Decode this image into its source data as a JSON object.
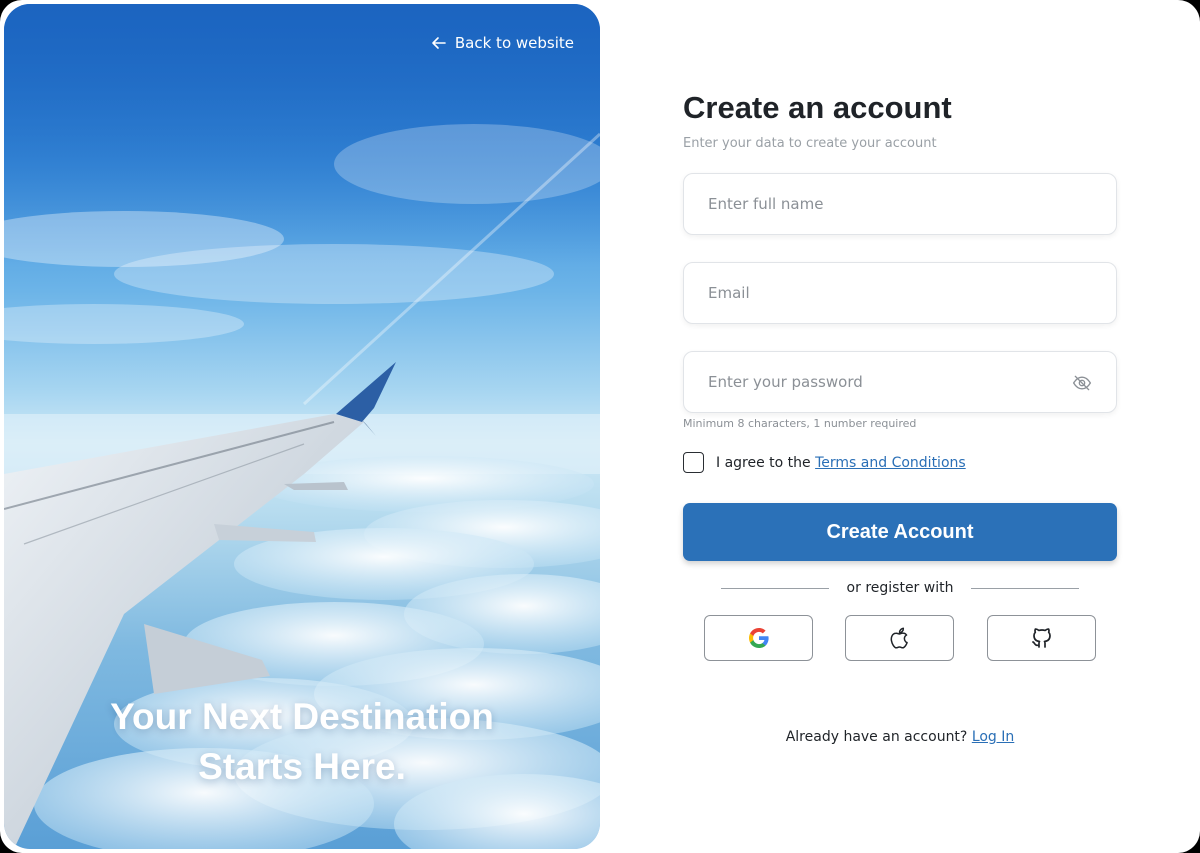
{
  "hero": {
    "back_link": "Back to website",
    "tagline_line1": "Your Next Destination",
    "tagline_line2": "Starts Here."
  },
  "form": {
    "title": "Create an account",
    "subtitle": "Enter your data to create your account",
    "full_name_placeholder": "Enter full name",
    "email_placeholder": "Email",
    "password_placeholder": "Enter your password",
    "password_hint": "Minimum 8 characters, 1 number required",
    "agree_prefix": "I agree to the ",
    "terms_link": "Terms and Conditions",
    "submit_label": "Create Account",
    "divider_text": "or register with",
    "login_prompt": "Already have an account? ",
    "login_link": "Log In"
  },
  "social": [
    {
      "name": "google-icon"
    },
    {
      "name": "apple-icon"
    },
    {
      "name": "github-icon"
    }
  ],
  "colors": {
    "primary": "#2b71b8",
    "link": "#2a6fb6",
    "text": "#1f2328",
    "muted": "#8b9096"
  }
}
